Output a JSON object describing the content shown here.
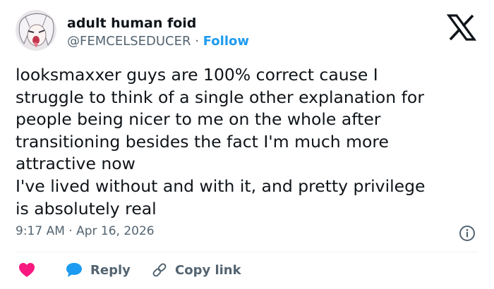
{
  "author": {
    "display_name": "adult human foid",
    "handle": "@FEMCELSEDUCER",
    "separator": "·",
    "follow_label": "Follow",
    "avatar_icon": "anime-avatar-icon"
  },
  "brand": {
    "logo_icon": "x-logo-icon"
  },
  "tweet": {
    "lines": [
      "looksmaxxer guys are 100% correct cause I",
      "struggle to think of a single other explanation for",
      "people being nicer to me on the whole after",
      "transitioning besides the fact I'm much more",
      "attractive now",
      "I've lived without and with it, and pretty privilege",
      "is absolutely real"
    ]
  },
  "meta": {
    "time": "9:17 AM",
    "separator": "·",
    "date": "Apr 16, 2026",
    "info_icon": "info-icon"
  },
  "actions": {
    "like_icon": "heart-icon",
    "reply_icon": "speech-bubble-icon",
    "reply_label": "Reply",
    "copy_icon": "link-icon",
    "copy_label": "Copy link"
  },
  "colors": {
    "text": "#0f1419",
    "secondary": "#536471",
    "accent": "#1d9bf0",
    "like": "#f91880",
    "divider": "#eff3f4"
  }
}
